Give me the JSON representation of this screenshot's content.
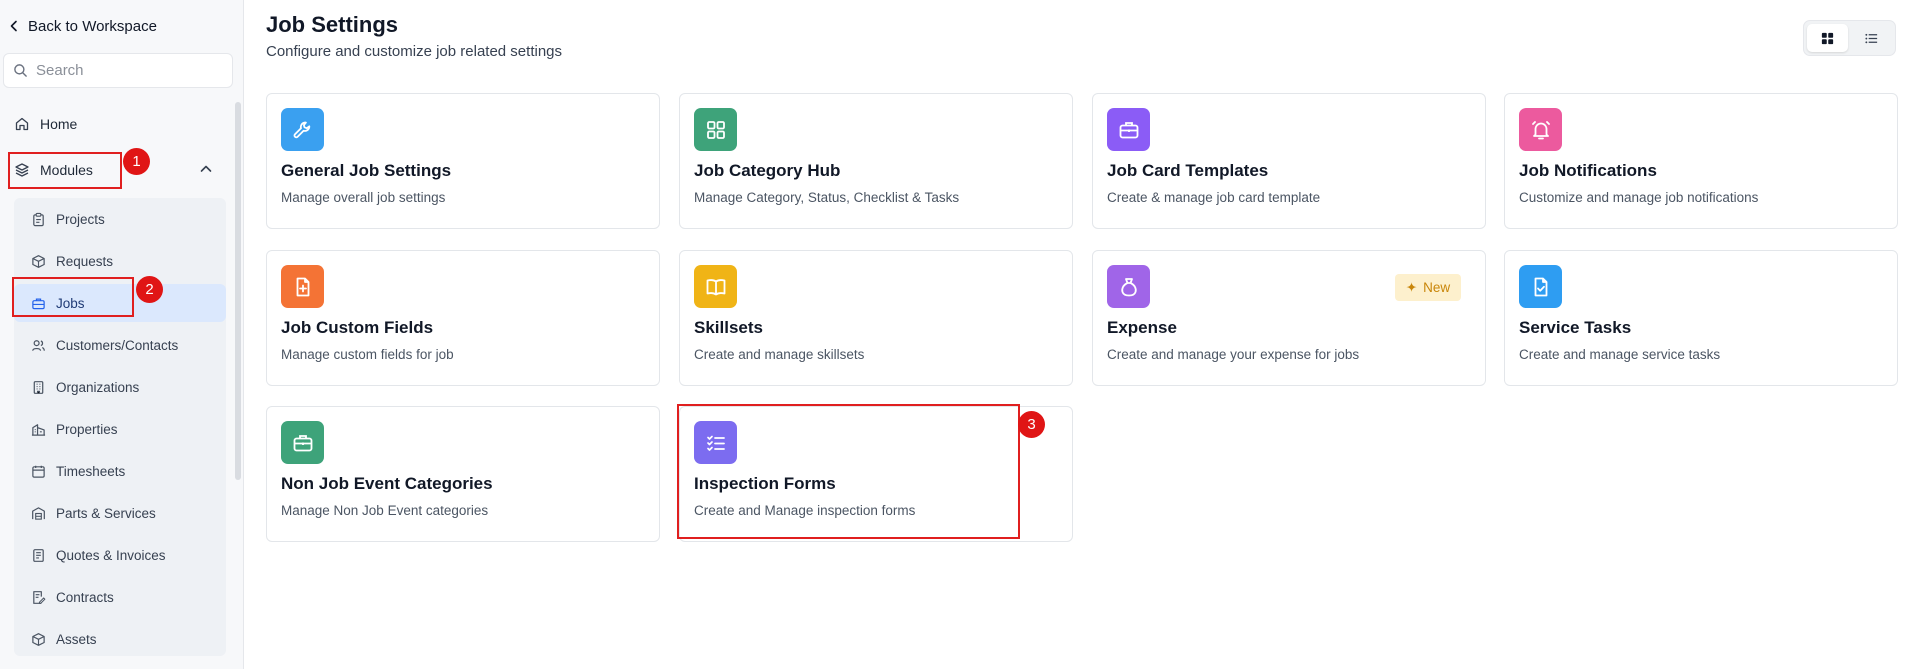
{
  "sidebar": {
    "back_label": "Back to Workspace",
    "search_placeholder": "Search",
    "home_label": "Home",
    "modules_label": "Modules",
    "items": [
      {
        "label": "Projects",
        "icon": "clipboard-icon"
      },
      {
        "label": "Requests",
        "icon": "box-icon"
      },
      {
        "label": "Jobs",
        "icon": "briefcase-icon",
        "active": true
      },
      {
        "label": "Customers/Contacts",
        "icon": "users-icon"
      },
      {
        "label": "Organizations",
        "icon": "building-icon"
      },
      {
        "label": "Properties",
        "icon": "property-icon"
      },
      {
        "label": "Timesheets",
        "icon": "calendar-icon"
      },
      {
        "label": "Parts & Services",
        "icon": "warehouse-icon"
      },
      {
        "label": "Quotes & Invoices",
        "icon": "invoice-icon"
      },
      {
        "label": "Contracts",
        "icon": "contract-icon"
      },
      {
        "label": "Assets",
        "icon": "cube-icon"
      }
    ]
  },
  "annotations": {
    "step1": "1",
    "step2": "2",
    "step3": "3"
  },
  "main": {
    "title": "Job Settings",
    "subtitle": "Configure and customize job related settings",
    "cards": [
      {
        "title": "General Job Settings",
        "description": "Manage overall job settings",
        "icon": "wrench-icon",
        "color": "#3aa0f0"
      },
      {
        "title": "Job Category Hub",
        "description": "Manage Category, Status, Checklist & Tasks",
        "icon": "grid-icon",
        "color": "#3ea37a"
      },
      {
        "title": "Job Card Templates",
        "description": "Create & manage job card template",
        "icon": "briefcase-icon",
        "color": "#8b5cf6"
      },
      {
        "title": "Job Notifications",
        "description": "Customize and manage job notifications",
        "icon": "bell-icon",
        "color": "#ec5a9e"
      },
      {
        "title": "Job Custom Fields",
        "description": "Manage custom fields for job",
        "icon": "file-plus-icon",
        "color": "#f47335"
      },
      {
        "title": "Skillsets",
        "description": "Create and manage skillsets",
        "icon": "book-icon",
        "color": "#f0b416"
      },
      {
        "title": "Expense",
        "description": "Create and manage your expense for jobs",
        "icon": "money-bag-icon",
        "color": "#a065e8",
        "badge": "New"
      },
      {
        "title": "Service Tasks",
        "description": "Create and manage service tasks",
        "icon": "file-check-icon",
        "color": "#2e9df2"
      },
      {
        "title": "Non Job Event Categories",
        "description": "Manage Non Job Event categories",
        "icon": "briefcase-icon",
        "color": "#3ea37a"
      },
      {
        "title": "Inspection Forms",
        "description": "Create and Manage inspection forms",
        "icon": "checklist-icon",
        "color": "#7c6cf0"
      }
    ]
  }
}
